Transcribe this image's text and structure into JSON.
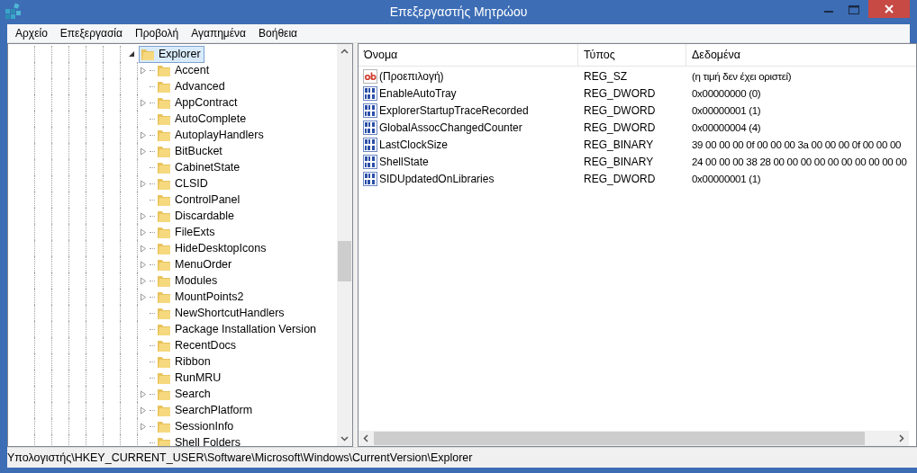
{
  "window": {
    "title": "Επεξεργαστής Μητρώου"
  },
  "menu": [
    "Αρχείο",
    "Επεξεργασία",
    "Προβολή",
    "Αγαπημένα",
    "Βοήθεια"
  ],
  "tree": {
    "label": "Explorer",
    "expanded": true,
    "selected": true,
    "children": [
      {
        "label": "Accent",
        "expandable": true,
        "selected": false
      },
      {
        "label": "Advanced",
        "expandable": false,
        "selected": false
      },
      {
        "label": "AppContract",
        "expandable": true,
        "selected": false
      },
      {
        "label": "AutoComplete",
        "expandable": false,
        "selected": false
      },
      {
        "label": "AutoplayHandlers",
        "expandable": true,
        "selected": false
      },
      {
        "label": "BitBucket",
        "expandable": true,
        "selected": false
      },
      {
        "label": "CabinetState",
        "expandable": false,
        "selected": false
      },
      {
        "label": "CLSID",
        "expandable": true,
        "selected": false
      },
      {
        "label": "ControlPanel",
        "expandable": false,
        "selected": false
      },
      {
        "label": "Discardable",
        "expandable": true,
        "selected": false
      },
      {
        "label": "FileExts",
        "expandable": true,
        "selected": false
      },
      {
        "label": "HideDesktopIcons",
        "expandable": true,
        "selected": false
      },
      {
        "label": "MenuOrder",
        "expandable": true,
        "selected": false
      },
      {
        "label": "Modules",
        "expandable": true,
        "selected": false
      },
      {
        "label": "MountPoints2",
        "expandable": true,
        "selected": false
      },
      {
        "label": "NewShortcutHandlers",
        "expandable": false,
        "selected": false
      },
      {
        "label": "Package Installation Version",
        "expandable": false,
        "selected": false
      },
      {
        "label": "RecentDocs",
        "expandable": false,
        "selected": false
      },
      {
        "label": "Ribbon",
        "expandable": false,
        "selected": false
      },
      {
        "label": "RunMRU",
        "expandable": false,
        "selected": false
      },
      {
        "label": "Search",
        "expandable": true,
        "selected": false
      },
      {
        "label": "SearchPlatform",
        "expandable": true,
        "selected": false
      },
      {
        "label": "SessionInfo",
        "expandable": true,
        "selected": false
      },
      {
        "label": "Shell Folders",
        "expandable": false,
        "selected": false
      }
    ]
  },
  "values": {
    "columns": [
      "Όνομα",
      "Τύπος",
      "Δεδομένα"
    ],
    "rows": [
      {
        "kind": "string",
        "name": "(Προεπιλογή)",
        "type": "REG_SZ",
        "data": "(η τιμή δεν έχει οριστεί)"
      },
      {
        "kind": "binary",
        "name": "EnableAutoTray",
        "type": "REG_DWORD",
        "data": "0x00000000 (0)"
      },
      {
        "kind": "binary",
        "name": "ExplorerStartupTraceRecorded",
        "type": "REG_DWORD",
        "data": "0x00000001 (1)"
      },
      {
        "kind": "binary",
        "name": "GlobalAssocChangedCounter",
        "type": "REG_DWORD",
        "data": "0x00000004 (4)"
      },
      {
        "kind": "binary",
        "name": "LastClockSize",
        "type": "REG_BINARY",
        "data": "39 00 00 00 0f 00 00 00 3a 00 00 00 0f 00 00 00"
      },
      {
        "kind": "binary",
        "name": "ShellState",
        "type": "REG_BINARY",
        "data": "24 00 00 00 38 28 00 00 00 00 00 00 00 00 00 00"
      },
      {
        "kind": "binary",
        "name": "SIDUpdatedOnLibraries",
        "type": "REG_DWORD",
        "data": "0x00000001 (1)"
      }
    ]
  },
  "status_bar": "Υπολογιστής\\HKEY_CURRENT_USER\\Software\\Microsoft\\Windows\\CurrentVersion\\Explorer"
}
